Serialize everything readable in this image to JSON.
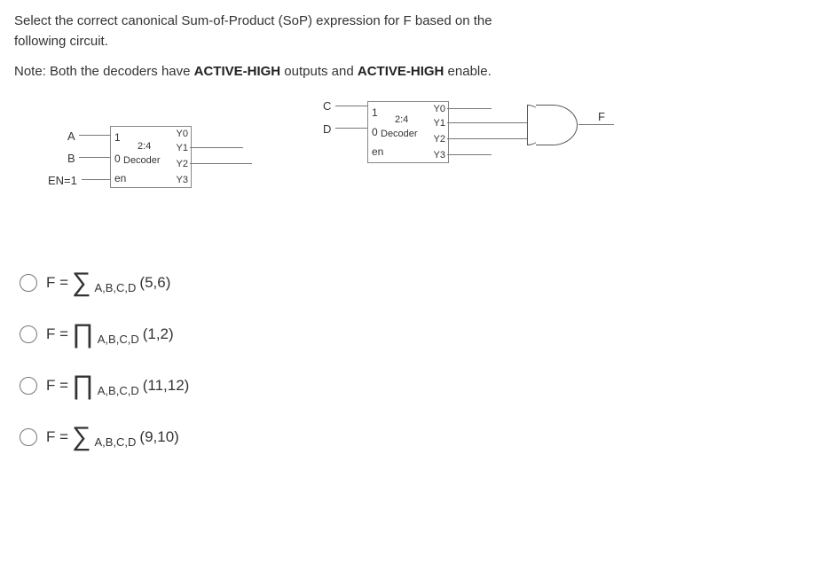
{
  "question": {
    "line1": "Select the correct canonical Sum-of-Product (SoP) expression for F based on the",
    "line2": "following circuit.",
    "note_pre": "Note: Both the decoders have ",
    "note_b1": "ACTIVE-HIGH",
    "note_mid": " outputs and ",
    "note_b2": "ACTIVE-HIGH",
    "note_post": " enable."
  },
  "diagram": {
    "decoderA": {
      "title": "2:4",
      "sub": "Decoder",
      "in1": "1",
      "in0": "0",
      "en": "en",
      "y0": "Y0",
      "y1": "Y1",
      "y2": "Y2",
      "y3": "Y3"
    },
    "decoderB": {
      "title": "2:4",
      "sub": "Decoder",
      "in1": "1",
      "in0": "0",
      "en": "en",
      "y0": "Y0",
      "y1": "Y1",
      "y2": "Y2",
      "y3": "Y3"
    },
    "signals": {
      "A": "A",
      "B": "B",
      "EN": "EN=1",
      "C": "C",
      "D": "D",
      "F": "F"
    }
  },
  "options": {
    "o1": {
      "pre": "F =",
      "sym": "∑",
      "sub": "A,B,C,D",
      "args": " (5,6)"
    },
    "o2": {
      "pre": "F =",
      "sym": "∏",
      "sub": "A,B,C,D",
      "args": " (1,2)"
    },
    "o3": {
      "pre": "F =",
      "sym": "∏",
      "sub": "A,B,C,D",
      "args": "(11,12)"
    },
    "o4": {
      "pre": "F =",
      "sym": "∑",
      "sub": "A,B,C,D",
      "args": "(9,10)"
    }
  }
}
